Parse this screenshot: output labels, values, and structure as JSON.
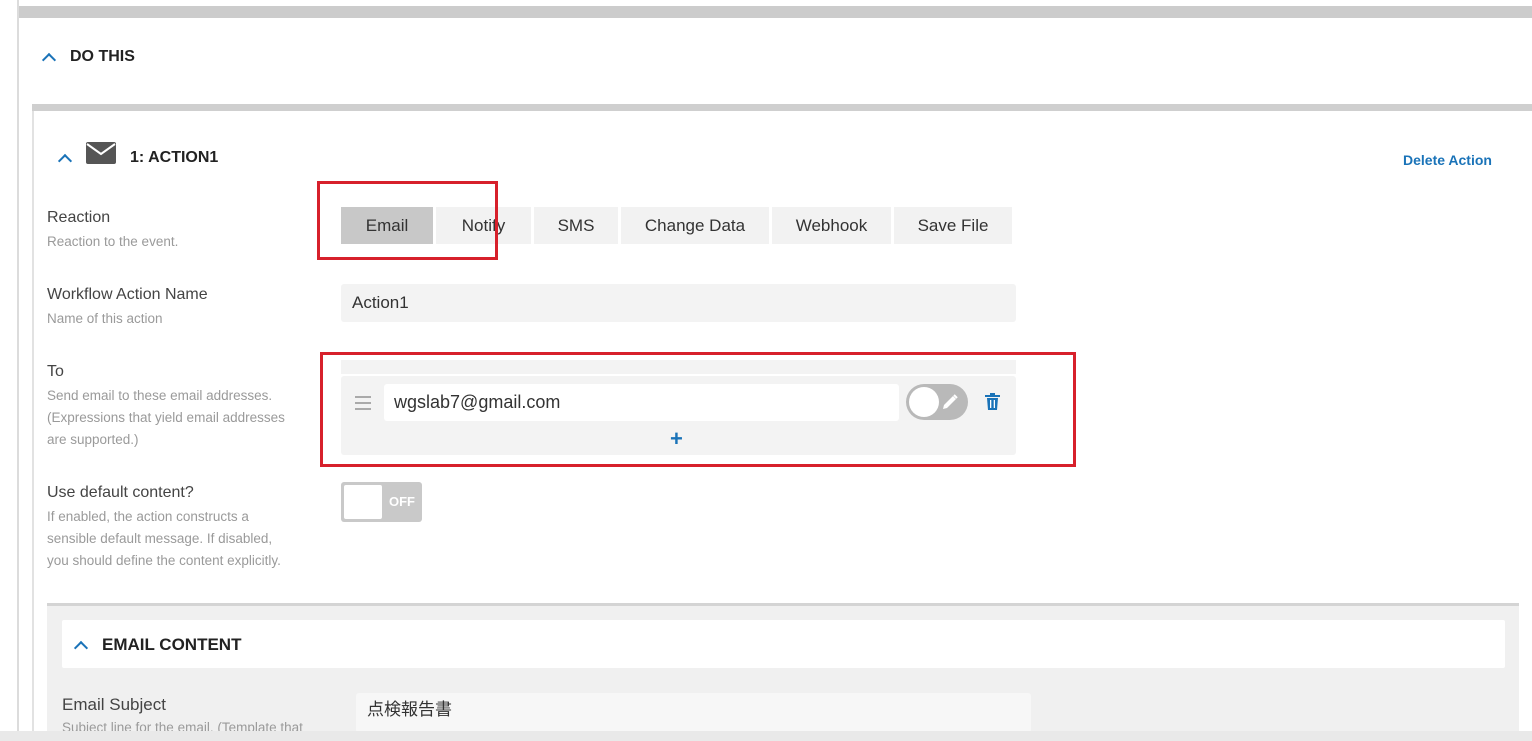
{
  "section": {
    "title": "DO THIS"
  },
  "action": {
    "title": "1: ACTION1",
    "delete_label": "Delete Action"
  },
  "reaction": {
    "label": "Reaction",
    "hint": "Reaction to the event.",
    "options": [
      "Email",
      "Notify",
      "SMS",
      "Change Data",
      "Webhook",
      "Save File"
    ],
    "selected": "Email"
  },
  "action_name": {
    "label": "Workflow Action Name",
    "hint": "Name of this action",
    "value": "Action1"
  },
  "to": {
    "label": "To",
    "hint_lines": [
      "Send email to these email addresses.",
      "(Expressions that yield email addresses",
      "are supported.)"
    ],
    "recipients": [
      "wgslab7@gmail.com"
    ],
    "add_label": "+"
  },
  "default_content": {
    "label": "Use default content?",
    "hint_lines": [
      "If enabled, the action constructs a",
      "sensible default message. If disabled,",
      "you should define the content explicitly."
    ],
    "toggle_text": "OFF"
  },
  "email_content": {
    "title": "EMAIL CONTENT",
    "subject_label": "Email Subject",
    "subject_hint": "Subject line for the email. (Template that",
    "subject_value": "点検報告書"
  },
  "colors": {
    "accent": "#1a73b8",
    "highlight": "#d7202b"
  },
  "icons": [
    "chevron-up-icon",
    "envelope-icon",
    "drag-handle-icon",
    "pencil-icon",
    "trash-icon",
    "plus-icon"
  ]
}
